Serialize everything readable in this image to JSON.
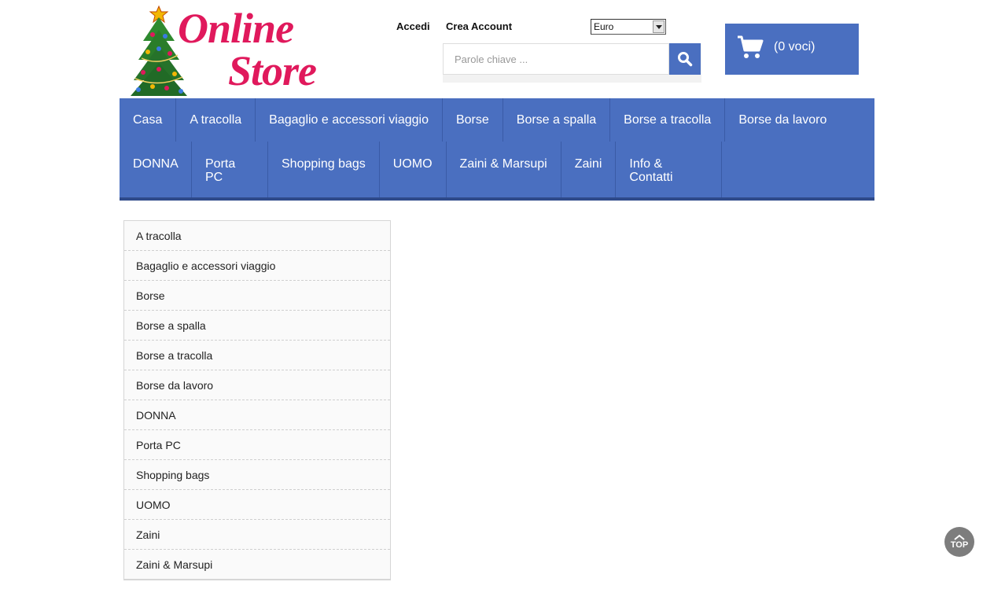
{
  "logo": {
    "line1": "Online",
    "line2": "Store"
  },
  "header": {
    "login_label": "Accedi",
    "signup_label": "Crea Account",
    "currency_selected": "Euro",
    "search_placeholder": "Parole chiave ...",
    "cart_label": "(0 voci)"
  },
  "nav": {
    "row1": [
      "Casa",
      "A tracolla",
      "Bagaglio e accessori viaggio",
      "Borse",
      "Borse a spalla",
      "Borse a tracolla",
      "Borse da lavoro"
    ],
    "row2": [
      "DONNA",
      "Porta PC",
      "Shopping bags",
      "UOMO",
      "Zaini & Marsupi",
      "Zaini",
      "Info & Contatti"
    ]
  },
  "categories": [
    "A tracolla",
    "Bagaglio e accessori viaggio",
    "Borse",
    "Borse a spalla",
    "Borse a tracolla",
    "Borse da lavoro",
    "DONNA",
    "Porta PC",
    "Shopping bags",
    "UOMO",
    "Zaini",
    "Zaini & Marsupi"
  ],
  "back_to_top": "TOP",
  "colors": {
    "brand_blue": "#4a6fc0",
    "logo_pink": "#e0195c"
  },
  "icons": {
    "search": "search-icon",
    "cart": "cart-icon",
    "back_to_top": "chevron-up-icon",
    "logo": "christmas-tree-icon"
  }
}
